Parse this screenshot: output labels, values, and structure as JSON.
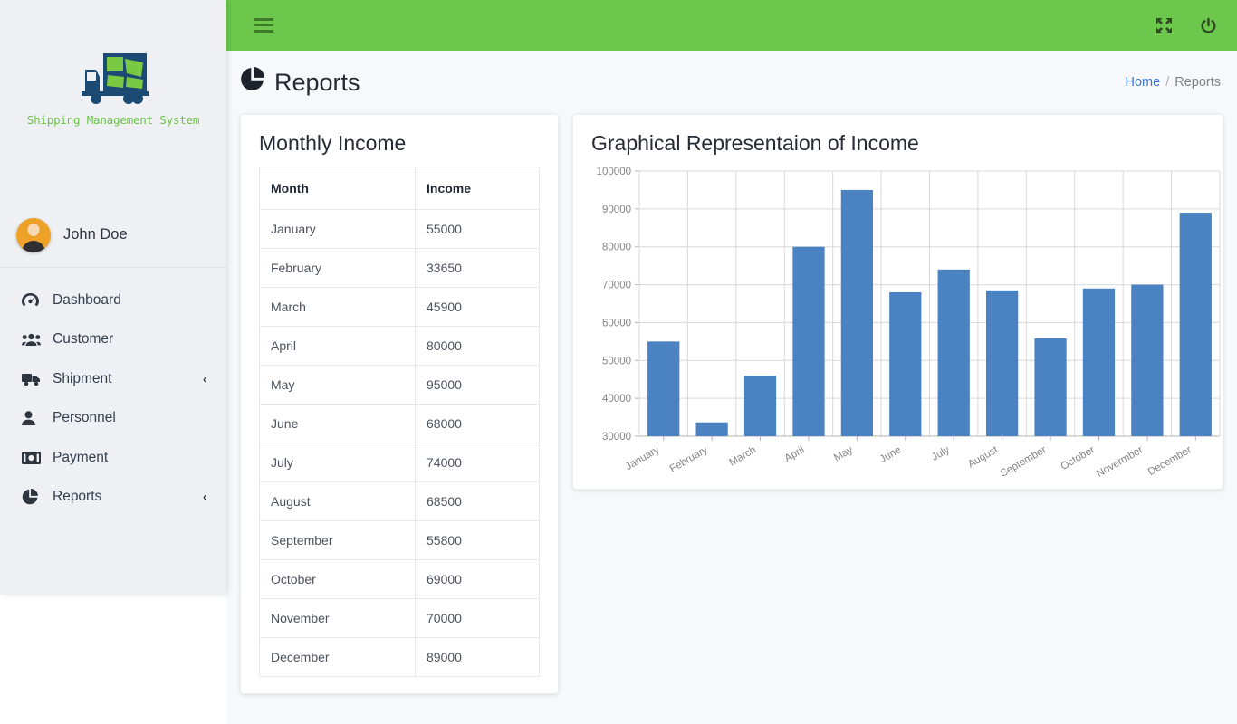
{
  "brand": {
    "name": "Shipping Management System",
    "logo_icon": "shipping-truck-logo"
  },
  "sidebar": {
    "user": {
      "name": "John Doe",
      "avatar_icon": "user-avatar"
    },
    "items": [
      {
        "label": "Dashboard",
        "icon": "dashboard-icon",
        "chevron": ""
      },
      {
        "label": "Customer",
        "icon": "customer-group-icon",
        "chevron": ""
      },
      {
        "label": "Shipment",
        "icon": "truck-icon",
        "chevron": "‹"
      },
      {
        "label": "Personnel",
        "icon": "person-icon",
        "chevron": ""
      },
      {
        "label": "Payment",
        "icon": "money-bill-icon",
        "chevron": ""
      },
      {
        "label": "Reports",
        "icon": "pie-chart-icon",
        "chevron": "‹"
      }
    ]
  },
  "topbar": {
    "menu_toggle_icon": "hamburger-menu-icon",
    "fullscreen_icon": "fullscreen-expand-icon",
    "power_icon": "power-logout-icon",
    "background_color": "#6cc74c"
  },
  "page": {
    "title": "Reports",
    "title_icon": "pie-chart-icon",
    "breadcrumb": {
      "home": "Home",
      "separator": "/",
      "current": "Reports"
    }
  },
  "income_table": {
    "title": "Monthly Income",
    "columns": [
      "Month",
      "Income"
    ],
    "rows": [
      [
        "January",
        "55000"
      ],
      [
        "February",
        "33650"
      ],
      [
        "March",
        "45900"
      ],
      [
        "April",
        "80000"
      ],
      [
        "May",
        "95000"
      ],
      [
        "June",
        "68000"
      ],
      [
        "July",
        "74000"
      ],
      [
        "August",
        "68500"
      ],
      [
        "September",
        "55800"
      ],
      [
        "October",
        "69000"
      ],
      [
        "November",
        "70000"
      ],
      [
        "December",
        "89000"
      ]
    ]
  },
  "chart_card": {
    "title": "Graphical Representaion of Income"
  },
  "chart_data": {
    "type": "bar",
    "title": "Graphical Representaion of Income",
    "xlabel": "",
    "ylabel": "",
    "categories": [
      "January",
      "February",
      "March",
      "April",
      "May",
      "June",
      "July",
      "August",
      "September",
      "October",
      "Novermber",
      "December"
    ],
    "values": [
      55000,
      33650,
      45900,
      80000,
      95000,
      68000,
      74000,
      68500,
      55800,
      69000,
      70000,
      89000
    ],
    "ylim": [
      30000,
      100000
    ],
    "yticks": [
      30000,
      40000,
      50000,
      60000,
      70000,
      80000,
      90000,
      100000
    ],
    "ytick_labels": [
      "30000",
      "40000",
      "50000",
      "60000",
      "70000",
      "80000",
      "90000",
      "100000"
    ],
    "grid": true,
    "legend": false,
    "bar_color": "#4a82c2",
    "grid_color": "#d9d9d9",
    "tick_label_color": "#848484",
    "xtick_rotation": -30
  }
}
